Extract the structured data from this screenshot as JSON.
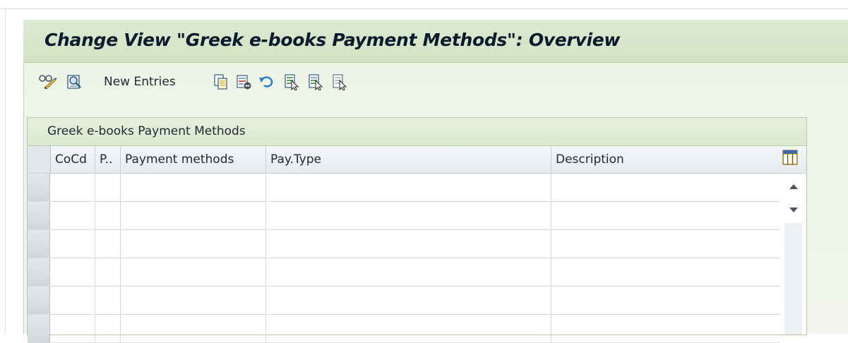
{
  "header": {
    "title": "Change View \"Greek e-books Payment Methods\": Overview"
  },
  "toolbar": {
    "buttons": [
      {
        "icon": "display-change-icon"
      },
      {
        "icon": "details-icon"
      },
      {
        "label": "New Entries"
      },
      {
        "icon": "copy-as-icon"
      },
      {
        "icon": "delete-icon"
      },
      {
        "icon": "undo-change-icon"
      },
      {
        "icon": "select-all-icon"
      },
      {
        "icon": "select-block-icon"
      },
      {
        "icon": "deselect-all-icon"
      }
    ]
  },
  "table": {
    "title": "Greek e-books Payment Methods",
    "columns": [
      "CoCd",
      "P..",
      "Payment methods",
      "Pay.Type",
      "Description"
    ],
    "visible_rows": 6,
    "rows": []
  },
  "colors": {
    "title_bar": "#d2e3c4",
    "panel_background": "#eef4e8",
    "table_title_bar": "#dbe8cf",
    "header_text": "#0b1a2c"
  }
}
